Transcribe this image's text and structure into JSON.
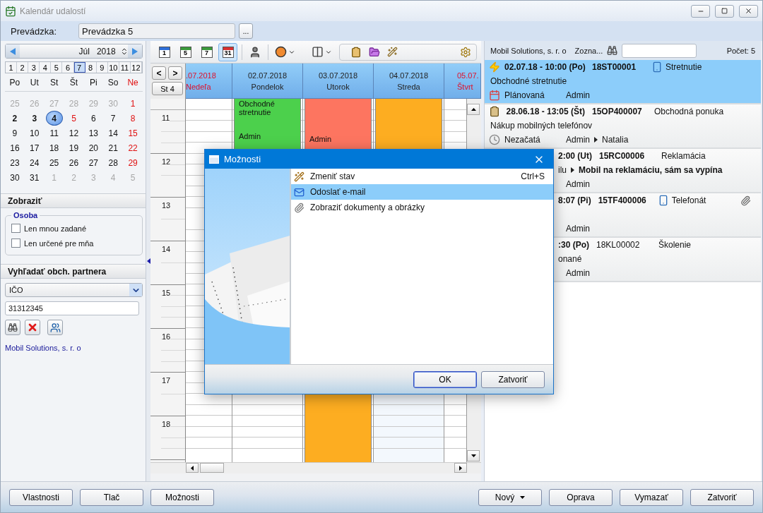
{
  "window": {
    "title": "Kalendár udalostí"
  },
  "branch": {
    "label": "Prevádzka:",
    "value": "Prevádzka 5",
    "browse": "..."
  },
  "month_picker": {
    "month": "Júl",
    "year": "2018"
  },
  "months": [
    {
      "label": "1",
      "selected": false
    },
    {
      "label": "2",
      "selected": false
    },
    {
      "label": "3",
      "selected": false
    },
    {
      "label": "4",
      "selected": false
    },
    {
      "label": "5",
      "selected": false
    },
    {
      "label": "6",
      "selected": false
    },
    {
      "label": "7",
      "selected": true
    },
    {
      "label": "8",
      "selected": false
    },
    {
      "label": "9",
      "selected": false
    },
    {
      "label": "10",
      "selected": false
    },
    {
      "label": "11",
      "selected": false
    },
    {
      "label": "12",
      "selected": false
    }
  ],
  "weekdays": [
    {
      "label": "Po",
      "weekend": false
    },
    {
      "label": "Ut",
      "weekend": false
    },
    {
      "label": "St",
      "weekend": false
    },
    {
      "label": "Št",
      "weekend": false
    },
    {
      "label": "Pi",
      "weekend": false
    },
    {
      "label": "So",
      "weekend": false
    },
    {
      "label": "Ne",
      "weekend": true
    }
  ],
  "days": [
    {
      "label": "25",
      "muted": true,
      "red": false,
      "bold": false,
      "selected": false
    },
    {
      "label": "26",
      "muted": true,
      "red": false,
      "bold": false,
      "selected": false
    },
    {
      "label": "27",
      "muted": true,
      "red": false,
      "bold": false,
      "selected": false
    },
    {
      "label": "28",
      "muted": true,
      "red": false,
      "bold": false,
      "selected": false
    },
    {
      "label": "29",
      "muted": true,
      "red": false,
      "bold": false,
      "selected": false
    },
    {
      "label": "30",
      "muted": true,
      "red": false,
      "bold": false,
      "selected": false
    },
    {
      "label": "1",
      "muted": false,
      "red": true,
      "bold": false,
      "selected": false
    },
    {
      "label": "2",
      "muted": false,
      "red": false,
      "bold": true,
      "selected": false
    },
    {
      "label": "3",
      "muted": false,
      "red": false,
      "bold": true,
      "selected": false
    },
    {
      "label": "4",
      "muted": false,
      "red": false,
      "bold": true,
      "selected": true
    },
    {
      "label": "5",
      "muted": false,
      "red": true,
      "bold": false,
      "selected": false
    },
    {
      "label": "6",
      "muted": false,
      "red": false,
      "bold": false,
      "selected": false
    },
    {
      "label": "7",
      "muted": false,
      "red": false,
      "bold": false,
      "selected": false
    },
    {
      "label": "8",
      "muted": false,
      "red": true,
      "bold": false,
      "selected": false
    },
    {
      "label": "9",
      "muted": false,
      "red": false,
      "bold": false,
      "selected": false
    },
    {
      "label": "10",
      "muted": false,
      "red": false,
      "bold": false,
      "selected": false
    },
    {
      "label": "11",
      "muted": false,
      "red": false,
      "bold": false,
      "selected": false
    },
    {
      "label": "12",
      "muted": false,
      "red": false,
      "bold": false,
      "selected": false
    },
    {
      "label": "13",
      "muted": false,
      "red": false,
      "bold": false,
      "selected": false
    },
    {
      "label": "14",
      "muted": false,
      "red": false,
      "bold": false,
      "selected": false
    },
    {
      "label": "15",
      "muted": false,
      "red": true,
      "bold": false,
      "selected": false
    },
    {
      "label": "16",
      "muted": false,
      "red": false,
      "bold": false,
      "selected": false
    },
    {
      "label": "17",
      "muted": false,
      "red": false,
      "bold": false,
      "selected": false
    },
    {
      "label": "18",
      "muted": false,
      "red": false,
      "bold": false,
      "selected": false
    },
    {
      "label": "19",
      "muted": false,
      "red": false,
      "bold": false,
      "selected": false
    },
    {
      "label": "20",
      "muted": false,
      "red": false,
      "bold": false,
      "selected": false
    },
    {
      "label": "21",
      "muted": false,
      "red": false,
      "bold": false,
      "selected": false
    },
    {
      "label": "22",
      "muted": false,
      "red": true,
      "bold": false,
      "selected": false
    },
    {
      "label": "23",
      "muted": false,
      "red": false,
      "bold": false,
      "selected": false
    },
    {
      "label": "24",
      "muted": false,
      "red": false,
      "bold": false,
      "selected": false
    },
    {
      "label": "25",
      "muted": false,
      "red": false,
      "bold": false,
      "selected": false
    },
    {
      "label": "26",
      "muted": false,
      "red": false,
      "bold": false,
      "selected": false
    },
    {
      "label": "27",
      "muted": false,
      "red": false,
      "bold": false,
      "selected": false
    },
    {
      "label": "28",
      "muted": false,
      "red": false,
      "bold": false,
      "selected": false
    },
    {
      "label": "29",
      "muted": false,
      "red": true,
      "bold": false,
      "selected": false
    },
    {
      "label": "30",
      "muted": false,
      "red": false,
      "bold": false,
      "selected": false
    },
    {
      "label": "31",
      "muted": false,
      "red": false,
      "bold": false,
      "selected": false
    },
    {
      "label": "1",
      "muted": true,
      "red": false,
      "bold": false,
      "selected": false
    },
    {
      "label": "2",
      "muted": true,
      "red": false,
      "bold": false,
      "selected": false
    },
    {
      "label": "3",
      "muted": true,
      "red": false,
      "bold": false,
      "selected": false
    },
    {
      "label": "4",
      "muted": true,
      "red": false,
      "bold": false,
      "selected": false
    },
    {
      "label": "5",
      "muted": true,
      "red": false,
      "bold": false,
      "selected": false
    }
  ],
  "display_section": {
    "title": "Zobraziť",
    "group": "Osoba",
    "options": [
      {
        "label": "Len mnou zadané",
        "checked": false
      },
      {
        "label": "Len určené pre mňa",
        "checked": false
      }
    ]
  },
  "partner_search": {
    "title": "Vyhľadať obch. partnera",
    "field": "IČO",
    "value": "31312345",
    "result": "Mobil Solutions, s. r. o"
  },
  "calendar": {
    "views": [
      {
        "label": "1",
        "color": "#2f6fd8",
        "selected": false
      },
      {
        "label": "5",
        "color": "#3b9a3b",
        "selected": false
      },
      {
        "label": "7",
        "color": "#3b9a3b",
        "selected": false
      },
      {
        "label": "31",
        "color": "#d83030",
        "selected": true
      }
    ],
    "prev": "<",
    "next": ">",
    "today": "St 4",
    "hours": [
      "11",
      "12",
      "13",
      "14",
      "15",
      "16",
      "17",
      "18"
    ],
    "columns": [
      {
        "date": ".07.2018",
        "day": "Nedeľa",
        "weekend": true,
        "today": false
      },
      {
        "date": "02.07.2018",
        "day": "Pondelok",
        "weekend": false,
        "today": false,
        "events": [
          {
            "title": "Obchodné stretnutie",
            "user": "Admin",
            "color": "#4cd04c"
          }
        ]
      },
      {
        "date": "03.07.2018",
        "day": "Utorok",
        "weekend": false,
        "today": false,
        "events": [
          {
            "user": "Admin",
            "color": "#fd7560"
          },
          {
            "color": "#fdad21"
          }
        ]
      },
      {
        "date": "04.07.2018",
        "day": "Streda",
        "weekend": false,
        "today": true,
        "events": [
          {
            "color": "#fdad21"
          }
        ]
      },
      {
        "date": "05.07.",
        "day": "Štvrt",
        "weekend": true,
        "today": false
      }
    ]
  },
  "agenda": {
    "company": "Mobil Solutions, s. r. o",
    "filter": "Zozna...",
    "count": "Počet: 5",
    "items": [
      {
        "kind": "full",
        "selected": true,
        "date": "02.07.18 - 10:00 (Po)",
        "number": "18ST00001",
        "bold": true,
        "type": "Stretnutie",
        "attachment": false,
        "description": "Obchodné stretnutie",
        "status": "Plánovaná",
        "user": "Admin"
      },
      {
        "kind": "full",
        "selected": false,
        "date": "28.06.18 - 13:05 (Št)",
        "number": "15OP400007",
        "bold": true,
        "type": "Obchodná ponuka",
        "attachment": false,
        "description": "Nákup mobilných telefónov",
        "status": "Nezačatá",
        "user": "Admin",
        "assignee": "Natalia"
      },
      {
        "kind": "partial",
        "selected": false,
        "date": "2:00 (Ut)",
        "number": "15RC00006",
        "bold": true,
        "type": "Reklamácia",
        "attachment": false,
        "description": "ilu",
        "subject": "Mobil na reklamáciu, sám sa vypína",
        "user": "Admin"
      },
      {
        "kind": "partial",
        "selected": false,
        "date": "8:07 (Pi)",
        "number": "15TF400006",
        "bold": true,
        "type": "Telefonát",
        "attachment": true,
        "user": "Admin"
      },
      {
        "kind": "partial",
        "selected": false,
        "date": ":30 (Po)",
        "number": "18KL00002",
        "bold": false,
        "type": "Školenie",
        "attachment": false,
        "description": "onané",
        "user": "Admin"
      }
    ]
  },
  "buttons_left": [
    "Vlastnosti",
    "Tlač",
    "Možnosti"
  ],
  "buttons_right": [
    {
      "label": "Nový",
      "dropdown": true
    },
    {
      "label": "Oprava",
      "dropdown": false
    },
    {
      "label": "Vymazať",
      "dropdown": false
    },
    {
      "label": "Zatvoriť",
      "dropdown": false
    }
  ],
  "dialog": {
    "title": "Možnosti",
    "options": [
      {
        "label": "Zmeniť stav",
        "shortcut": "Ctrl+S",
        "selected": false
      },
      {
        "label": "Odoslať e-mail",
        "selected": true
      },
      {
        "label": "Zobraziť dokumenty a obrázky",
        "selected": false
      }
    ],
    "ok": "OK",
    "close": "Zatvoriť"
  }
}
